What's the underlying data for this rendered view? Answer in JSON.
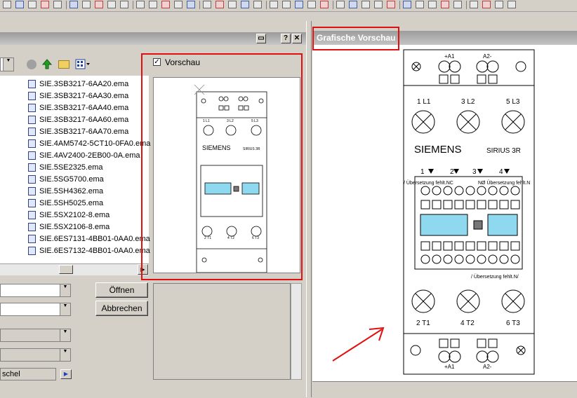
{
  "dialog": {
    "file_type_label_partial": "schel",
    "open_button": "Öffnen",
    "cancel_button": "Abbrechen",
    "preview_checkbox_label": "Vorschau",
    "preview_checked": true
  },
  "files": [
    "SIE.3SB3217-6AA20.ema",
    "SIE.3SB3217-6AA30.ema",
    "SIE.3SB3217-6AA40.ema",
    "SIE.3SB3217-6AA60.ema",
    "SIE.3SB3217-6AA70.ema",
    "SIE.4AM5742-5CT10-0FA0.ema",
    "SIE.4AV2400-2EB00-0A.ema",
    "SIE.5SE2325.ema",
    "SIE.5SG5700.ema",
    "SIE.5SH4362.ema",
    "SIE.5SH5025.ema",
    "SIE.5SX2102-8.ema",
    "SIE.5SX2106-8.ema",
    "SIE.6ES7131-4BB01-0AA0.ema",
    "SIE.6ES7132-4BB01-0AA0.ema"
  ],
  "preview_panel": {
    "title": "Grafische Vorschau"
  },
  "device": {
    "top_terminals": [
      "+A1",
      "A2-"
    ],
    "phase_terminals_top": [
      "1 L1",
      "3 L2",
      "5 L3"
    ],
    "brand": "SIEMENS",
    "series": "SIRIUS 3R",
    "aux_numbers": [
      "1",
      "2",
      "3",
      "4"
    ],
    "note_left": "/ Übersetzung fehlt.NC",
    "note_right": "NØ Übersetzung fehlt.N",
    "note_bottom": "/ Übersetzung fehlt.N/",
    "phase_terminals_bottom": [
      "2 T1",
      "4 T2",
      "6 T3"
    ],
    "bottom_terminals": [
      "+A1",
      "A2-"
    ]
  },
  "colors": {
    "highlight": "#e01010",
    "display_cyan": "#8ed8f0",
    "arrow": "#e01010"
  },
  "icons": [
    "back-icon",
    "up-folder-icon",
    "new-folder-icon",
    "view-menu-icon",
    "close-icon",
    "help-icon",
    "dock-icon"
  ]
}
